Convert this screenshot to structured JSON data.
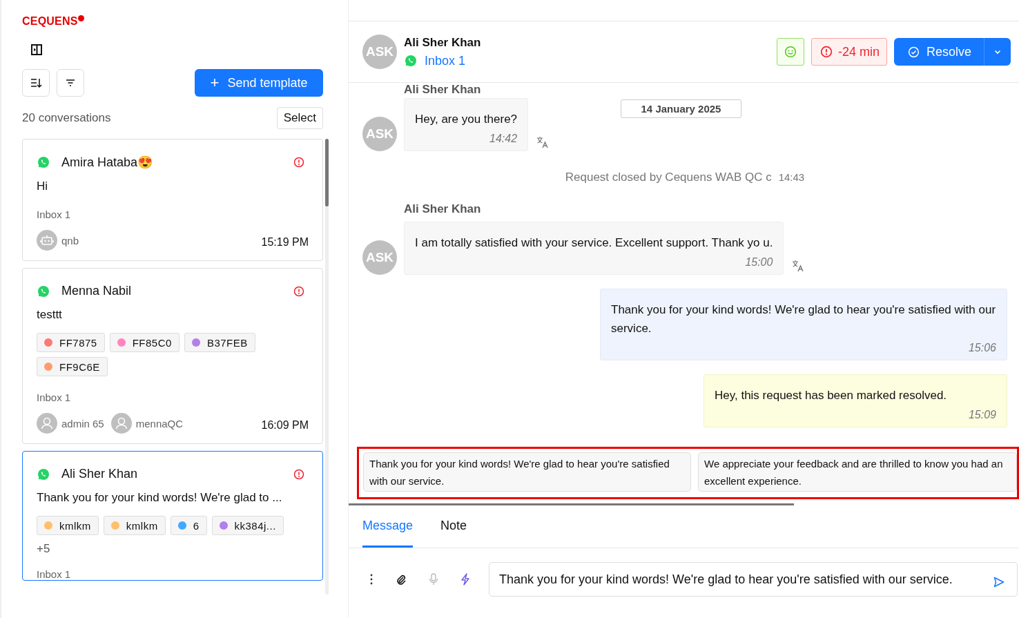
{
  "brand": {
    "logo": "CEQUENS"
  },
  "sidebar": {
    "send_template": {
      "icon": "+",
      "label": "Send template"
    },
    "count": "20 conversations",
    "select": "Select",
    "conversations": [
      {
        "name": "Amira Hataba",
        "emoji": "😍",
        "preview": "Hi",
        "inbox": "Inbox 1",
        "agents": [
          {
            "kind": "bot",
            "name": "qnb"
          }
        ],
        "time": "15:19 PM",
        "selected": false
      },
      {
        "name": "Menna Nabil",
        "preview": "testtt",
        "tags": [
          {
            "label": "FF7875",
            "color": "#ff7875"
          },
          {
            "label": "FF85C0",
            "color": "#ff85c0"
          },
          {
            "label": "B37FEB",
            "color": "#b37feb"
          },
          {
            "label": "FF9C6E",
            "color": "#ff9c6e"
          }
        ],
        "inbox": "Inbox 1",
        "agents": [
          {
            "kind": "user",
            "name": "admin 65"
          },
          {
            "kind": "user",
            "name": "mennaQC"
          }
        ],
        "time": "16:09 PM",
        "selected": false
      },
      {
        "name": "Ali Sher Khan",
        "preview": "Thank you for your kind words! We're glad to ...",
        "tags": [
          {
            "label": "kmlkm",
            "color": "#ffc069"
          },
          {
            "label": "kmlkm",
            "color": "#ffc069"
          },
          {
            "label": "6",
            "color": "#40a9ff"
          },
          {
            "label": "kk384j...",
            "color": "#b37feb"
          }
        ],
        "more": "+5",
        "inbox": "Inbox 1",
        "selected": true
      }
    ]
  },
  "chat": {
    "header": {
      "initials": "ASK",
      "name": "Ali Sher Khan",
      "inbox": "Inbox 1",
      "sla": "-24 min",
      "resolve": "Resolve"
    },
    "date": "14 January 2025",
    "messages": [
      {
        "kind": "incoming",
        "sender": "Ali Sher Khan",
        "initials": "ASK",
        "text": "Hey, are you there?",
        "time": "14:42"
      },
      {
        "kind": "system",
        "text": "Request closed by Cequens WAB QC c",
        "time": "14:43"
      },
      {
        "kind": "incoming",
        "sender": "Ali Sher Khan",
        "initials": "ASK",
        "text": "I am totally satisfied with your service. Excellent support. Thank yo u.",
        "time": "15:00"
      },
      {
        "kind": "outgoing",
        "text": "Thank you for your kind words! We're glad to hear you're satisfied with our service.",
        "time": "15:06"
      },
      {
        "kind": "resolved",
        "text": "Hey, this request has been marked resolved.",
        "time": "15:09"
      }
    ],
    "suggestions": [
      "Thank you for your kind words! We're glad to hear you're satisfied with our service.",
      "We appreciate your feedback and are thrilled to know you had an excellent experience."
    ],
    "tabs": [
      {
        "label": "Message",
        "selected": true
      },
      {
        "label": "Note",
        "selected": false
      }
    ],
    "composer": {
      "value": "Thank you for your kind words! We're glad to hear you're satisfied with our service.",
      "mic_disabled": true
    }
  }
}
